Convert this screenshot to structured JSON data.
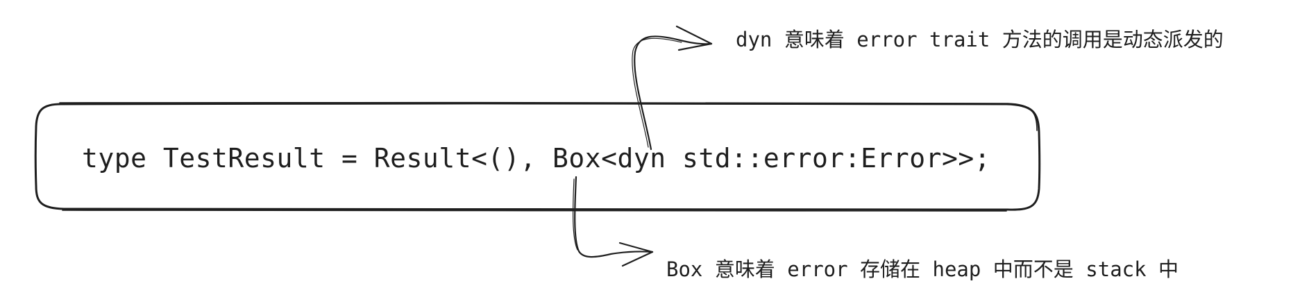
{
  "code": {
    "text": "type TestResult = Result<(), Box<dyn std::error:Error>>;"
  },
  "annotations": {
    "dyn_note": "dyn 意味着 error trait 方法的调用是动态派发的",
    "box_note": "Box 意味着 error 存储在 heap 中而不是 stack 中"
  }
}
